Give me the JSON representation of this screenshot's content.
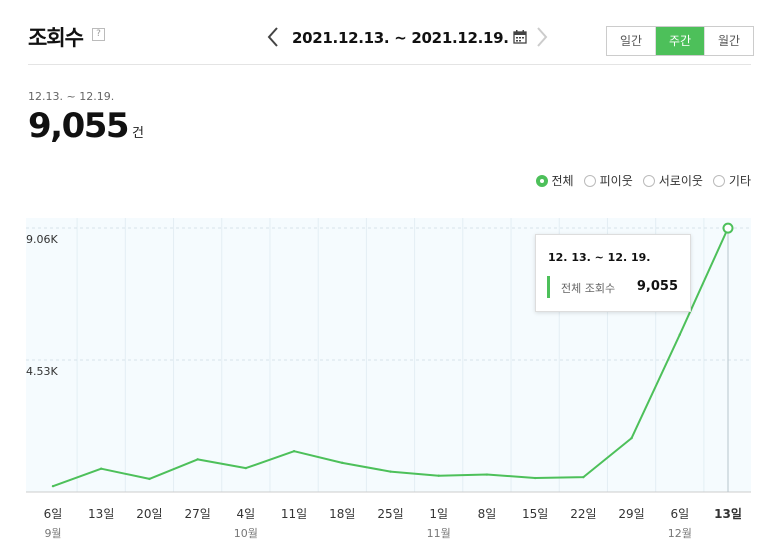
{
  "header": {
    "title": "조회수",
    "help_glyph": "?",
    "date_range": "2021.12.13. ~ 2021.12.19.",
    "period_tabs": [
      {
        "label": "일간",
        "active": false
      },
      {
        "label": "주간",
        "active": true
      },
      {
        "label": "월간",
        "active": false
      }
    ]
  },
  "summary": {
    "range_label": "12.13. ~ 12.19.",
    "total": "9,055",
    "unit": "건"
  },
  "filters": [
    {
      "label": "전체",
      "selected": true
    },
    {
      "label": "피이웃",
      "selected": false
    },
    {
      "label": "서로이웃",
      "selected": false
    },
    {
      "label": "기타",
      "selected": false
    }
  ],
  "colors": {
    "accent": "#4dc05a",
    "plot_bg": "#f5fbfe",
    "grid": "#e3eef4"
  },
  "chart_data": {
    "type": "line",
    "x": [
      "6일",
      "13일",
      "20일",
      "27일",
      "4일",
      "11일",
      "18일",
      "25일",
      "1일",
      "8일",
      "15일",
      "22일",
      "29일",
      "6일",
      "13일"
    ],
    "month_labels": [
      "9월",
      "",
      "",
      "",
      "10월",
      "",
      "",
      "",
      "11월",
      "",
      "",
      "",
      "",
      "12월",
      ""
    ],
    "series": [
      {
        "values": [
          200,
          800,
          450,
          1120,
          820,
          1400,
          1000,
          700,
          560,
          600,
          480,
          510,
          1850,
          5400,
          9055
        ]
      }
    ],
    "y_ticks": [
      "4.53K",
      "9.06K"
    ],
    "ylim": [
      0,
      9060
    ],
    "highlight_index": 14,
    "tooltip": {
      "title": "12. 13. ~ 12. 19.",
      "label": "전체 조회수",
      "value": "9,055"
    }
  }
}
